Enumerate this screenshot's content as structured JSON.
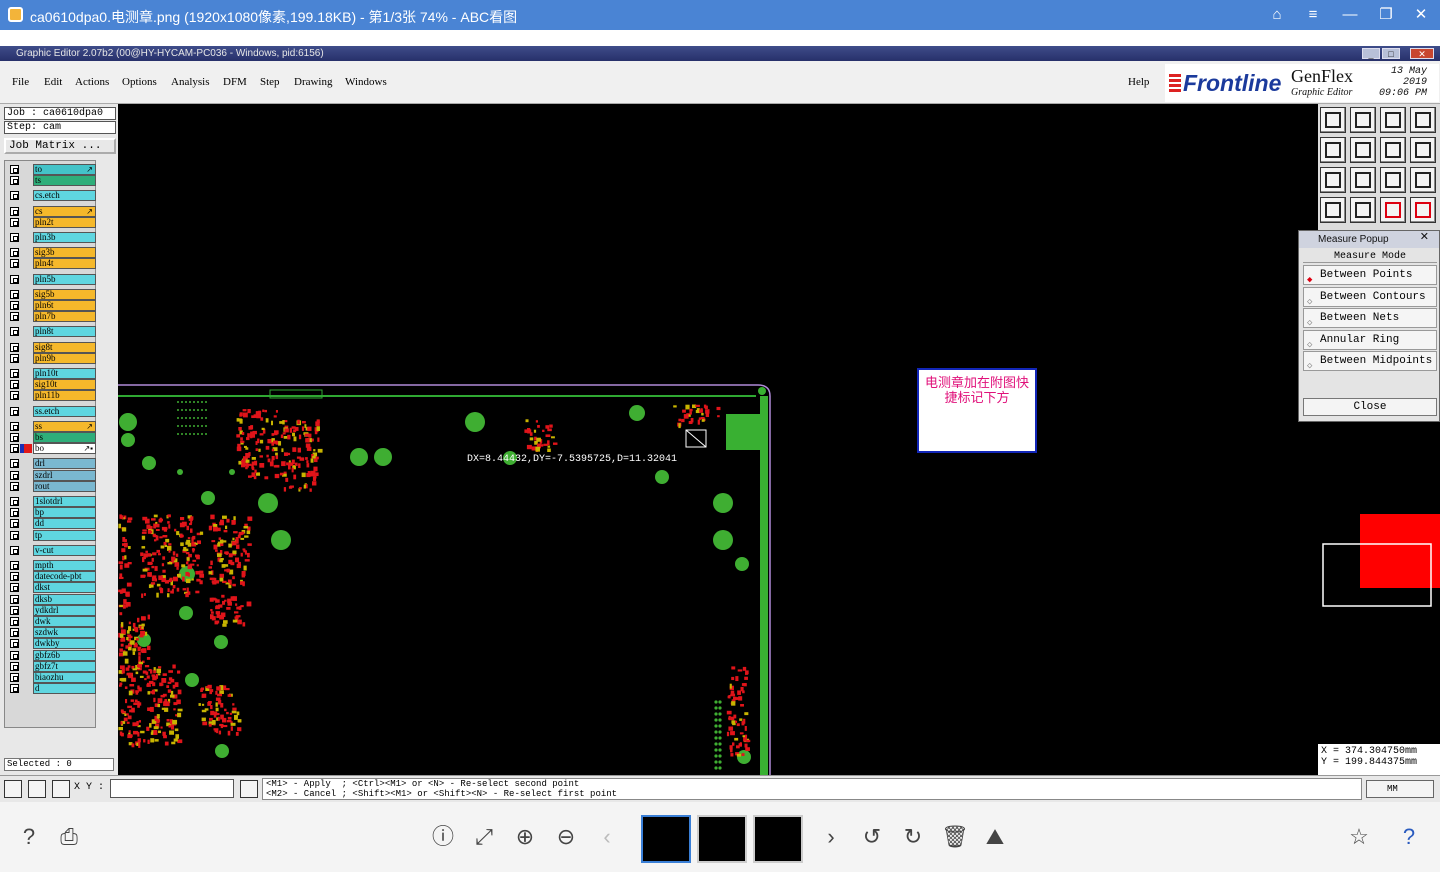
{
  "viewer": {
    "title": "ca0610dpa0.电测章.png (1920x1080像素,199.18KB) - 第1/3张 74% - ABC看图"
  },
  "editor": {
    "title": "Graphic Editor 2.07b2 (00@HY-HYCAM-PC036 - Windows, pid:6156)"
  },
  "menu": {
    "file": "File",
    "edit": "Edit",
    "actions": "Actions",
    "options": "Options",
    "analysis": "Analysis",
    "dfm": "DFM",
    "step": "Step",
    "drawing": "Drawing",
    "windows": "Windows",
    "help": "Help"
  },
  "brand": {
    "frontline": "Frontline",
    "genflex": "GenFlex",
    "subtitle": "Graphic Editor",
    "date": "13 May 2019",
    "time": "09:06 PM"
  },
  "job": {
    "job": "Job : ca0610dpa0",
    "step": "Step: cam",
    "matrix": "Job Matrix ..."
  },
  "layers": [
    {
      "name": "to",
      "color": "#44c3c8",
      "mark": "↗"
    },
    {
      "name": "ts",
      "color": "#2fae7a"
    },
    {
      "name": "cs.etch",
      "color": "#5fd6e0"
    },
    {
      "name": "cs",
      "color": "#f5b82b",
      "mark": "↗"
    },
    {
      "name": "pln2t",
      "color": "#f5b82b"
    },
    {
      "name": "pln3b",
      "color": "#5fd6e0"
    },
    {
      "name": "sig3b",
      "color": "#f5b82b"
    },
    {
      "name": "pln4t",
      "color": "#f5b82b"
    },
    {
      "name": "pln5b",
      "color": "#5fd6e0"
    },
    {
      "name": "sig5b",
      "color": "#f5b82b"
    },
    {
      "name": "pln6t",
      "color": "#f5b82b"
    },
    {
      "name": "pln7b",
      "color": "#f5b82b"
    },
    {
      "name": "pln8t",
      "color": "#5fd6e0"
    },
    {
      "name": "sig8t",
      "color": "#f5b82b"
    },
    {
      "name": "pln9b",
      "color": "#f5b82b"
    },
    {
      "name": "pln10t",
      "color": "#5fd6e0"
    },
    {
      "name": "sig10t",
      "color": "#f5b82b"
    },
    {
      "name": "pln11b",
      "color": "#f5b82b"
    },
    {
      "name": "ss.etch",
      "color": "#5fd6e0"
    },
    {
      "name": "ss",
      "color": "#f5b82b",
      "mark": "↗"
    },
    {
      "name": "bs",
      "color": "#2fae7a"
    },
    {
      "name": "bo",
      "color": "#ffffff",
      "mark": "↗▪"
    },
    {
      "name": "drl",
      "color": "#7ab8d0"
    },
    {
      "name": "szdrl",
      "color": "#7ab8d0"
    },
    {
      "name": "rout",
      "color": "#7ab8d0"
    },
    {
      "name": "1slotdrl",
      "color": "#5fd6e0"
    },
    {
      "name": "bp",
      "color": "#5fd6e0"
    },
    {
      "name": "dd",
      "color": "#5fd6e0"
    },
    {
      "name": "tp",
      "color": "#5fd6e0"
    },
    {
      "name": "v-cut",
      "color": "#5fd6e0"
    },
    {
      "name": "mpth",
      "color": "#5fd6e0"
    },
    {
      "name": "datecode-pbt",
      "color": "#5fd6e0"
    },
    {
      "name": "dkst",
      "color": "#5fd6e0"
    },
    {
      "name": "dksb",
      "color": "#5fd6e0"
    },
    {
      "name": "ydkdrl",
      "color": "#5fd6e0"
    },
    {
      "name": "dwk",
      "color": "#5fd6e0"
    },
    {
      "name": "szdwk",
      "color": "#5fd6e0"
    },
    {
      "name": "dwkby",
      "color": "#5fd6e0"
    },
    {
      "name": "gbfz6b",
      "color": "#5fd6e0"
    },
    {
      "name": "gbfz7t",
      "color": "#5fd6e0"
    },
    {
      "name": "biaozhu",
      "color": "#5fd6e0"
    },
    {
      "name": "d",
      "color": "#5fd6e0"
    }
  ],
  "selected": "Selected : 0",
  "canvas": {
    "measure": "DX=8.44432,DY=-7.5395725,D=11.32041",
    "note": "电测章加在附图快捷标记下方"
  },
  "measure_popup": {
    "title": "Measure Popup",
    "mode_label": "Measure Mode",
    "options": [
      "Between Points",
      "Between Contours",
      "Between Nets",
      "Annular Ring",
      "Between Midpoints"
    ],
    "close": "Close"
  },
  "coords": {
    "x": "X = 374.304750mm",
    "y": "Y = 199.844375mm"
  },
  "status": {
    "xy_label": "X Y :",
    "help_line1": "<M1> - Apply  ; <Ctrl><M1> or <N> - Re-select second point",
    "help_line2": "<M2> - Cancel ; <Shift><M1> or <Shift><N> - Re-select first point",
    "units": "MM"
  }
}
